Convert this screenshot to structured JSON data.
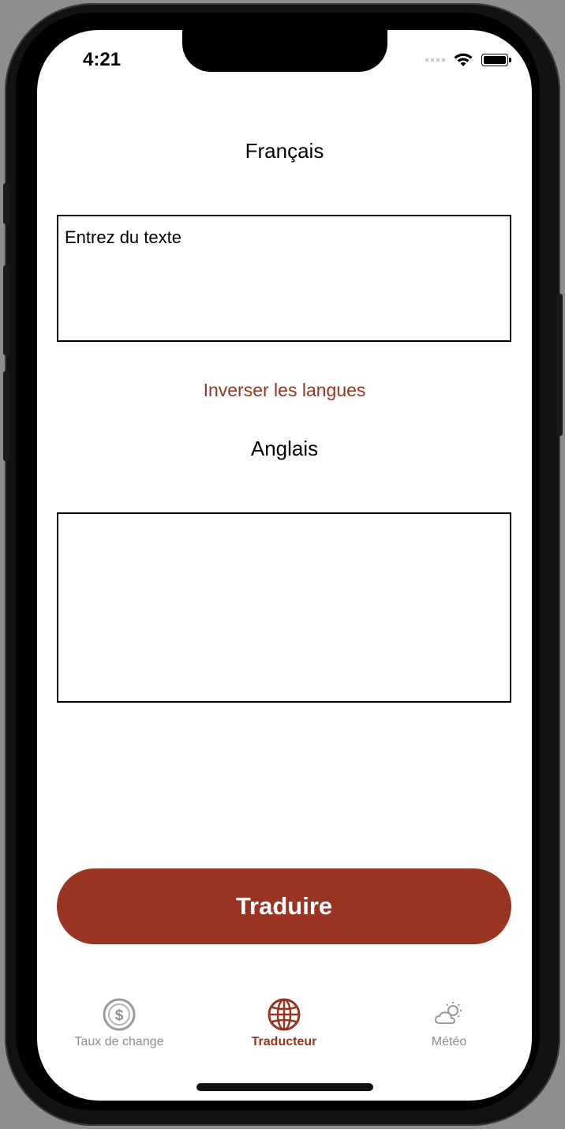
{
  "status_bar": {
    "time": "4:21"
  },
  "source_language": {
    "label": "Français",
    "input_placeholder": "Entrez du texte",
    "input_value": ""
  },
  "swap_label": "Inverser les langues",
  "target_language": {
    "label": "Anglais",
    "output_value": ""
  },
  "translate_button": {
    "label": "Traduire"
  },
  "tab_bar": {
    "items": [
      {
        "label": "Taux de change",
        "icon": "dollar-coin-icon",
        "active": false
      },
      {
        "label": "Traducteur",
        "icon": "globe-icon",
        "active": true
      },
      {
        "label": "Météo",
        "icon": "cloud-sun-icon",
        "active": false
      }
    ]
  },
  "colors": {
    "accent": "#993322",
    "inactive": "#8e8e8e",
    "background": "#ffffff"
  }
}
